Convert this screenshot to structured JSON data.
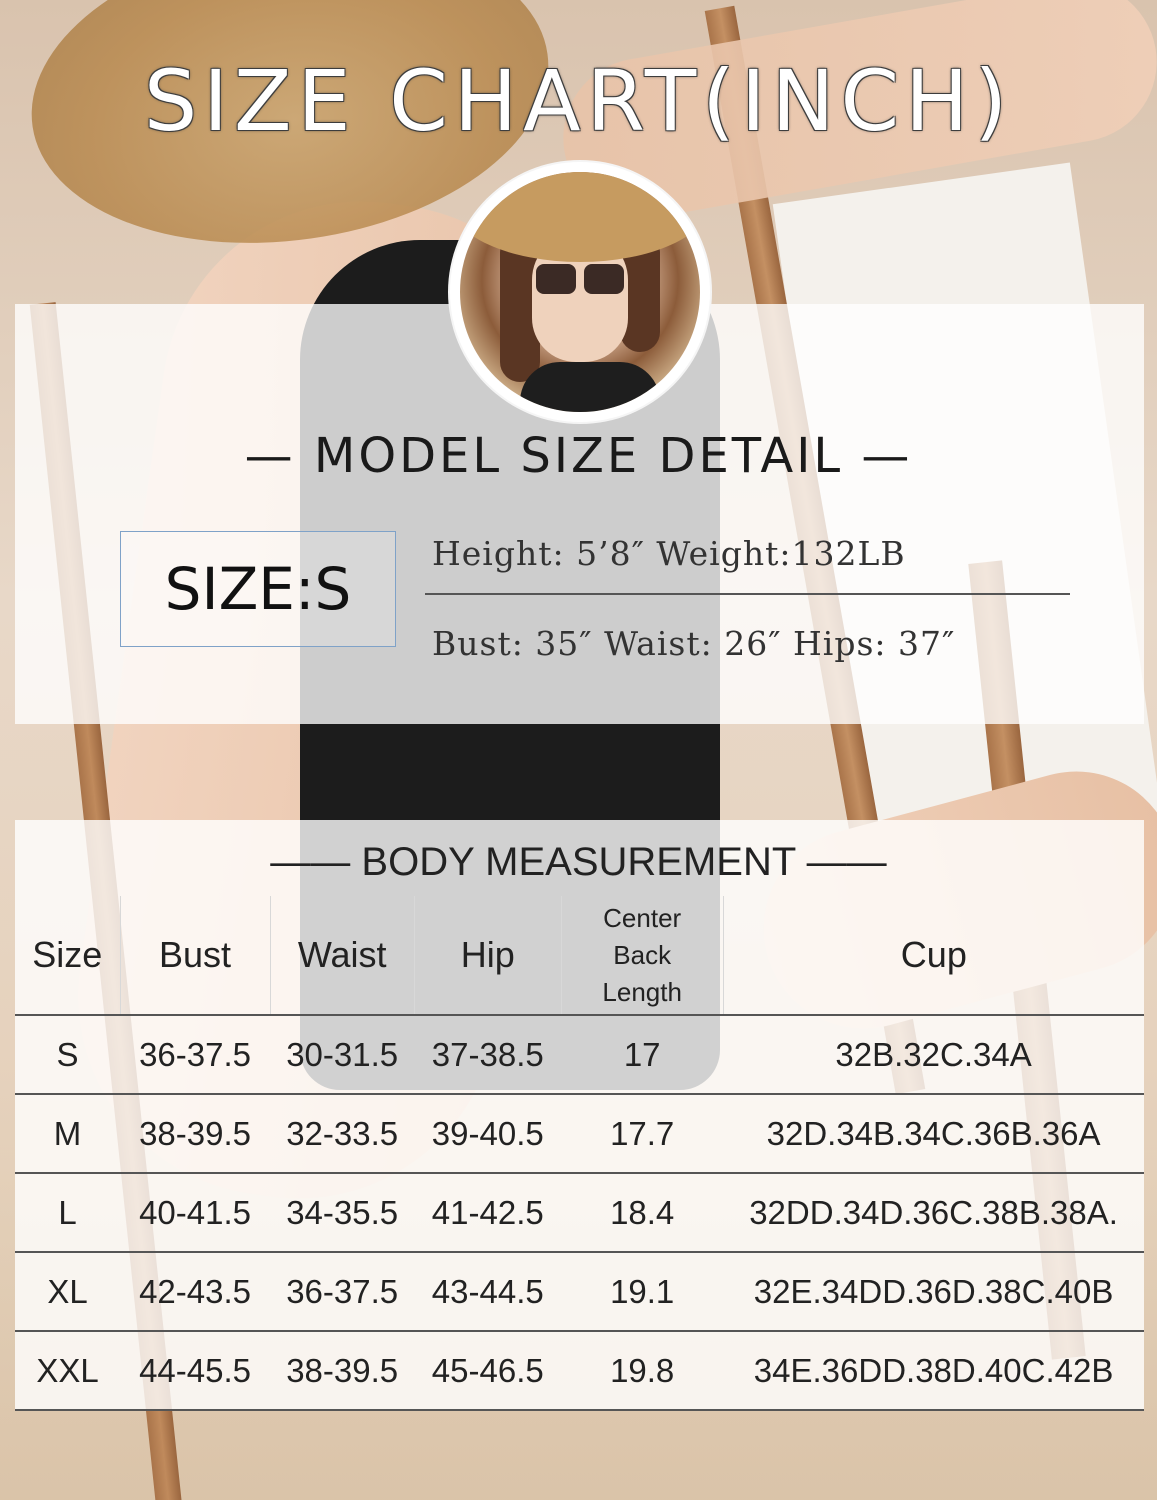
{
  "title": "SIZE CHART(INCH)",
  "model": {
    "heading": "— MODEL SIZE DETAIL —",
    "size_label": "SIZE:S",
    "line1": "Height: 5’8″  Weight:132LB",
    "line2": "Bust: 35″ Waist: 26″ Hips: 37″"
  },
  "table": {
    "heading": "—— BODY MEASUREMENT ——",
    "columns": {
      "size": "Size",
      "bust": "Bust",
      "waist": "Waist",
      "hip": "Hip",
      "cbl_1": "Center",
      "cbl_2": "Back",
      "cbl_3": "Length",
      "cup": "Cup"
    },
    "rows": [
      {
        "size": "S",
        "bust": "36-37.5",
        "waist": "30-31.5",
        "hip": "37-38.5",
        "cbl": "17",
        "cup": "32B.32C.34A"
      },
      {
        "size": "M",
        "bust": "38-39.5",
        "waist": "32-33.5",
        "hip": "39-40.5",
        "cbl": "17.7",
        "cup": "32D.34B.34C.36B.36A"
      },
      {
        "size": "L",
        "bust": "40-41.5",
        "waist": "34-35.5",
        "hip": "41-42.5",
        "cbl": "18.4",
        "cup": "32DD.34D.36C.38B.38A."
      },
      {
        "size": "XL",
        "bust": "42-43.5",
        "waist": "36-37.5",
        "hip": "43-44.5",
        "cbl": "19.1",
        "cup": "32E.34DD.36D.38C.40B"
      },
      {
        "size": "XXL",
        "bust": "44-45.5",
        "waist": "38-39.5",
        "hip": "45-46.5",
        "cbl": "19.8",
        "cup": "34E.36DD.38D.40C.42B"
      }
    ]
  }
}
